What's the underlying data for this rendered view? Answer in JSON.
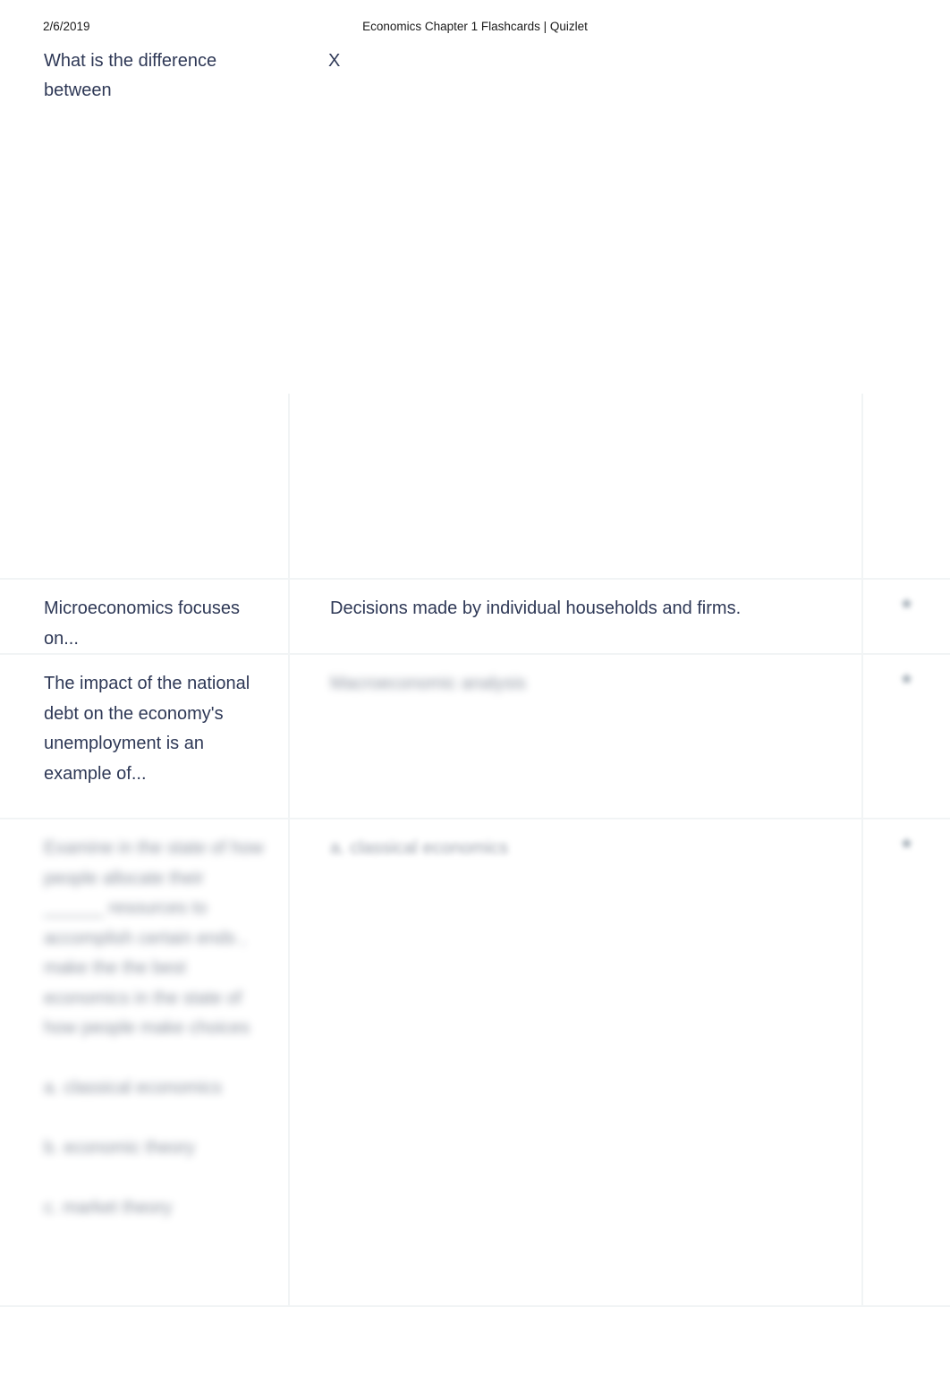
{
  "print_header": {
    "date": "2/6/2019",
    "document_title": "Economics Chapter 1 Flashcards | Quizlet"
  },
  "top_fragment": {
    "term": "What is the difference between",
    "definition": "X"
  },
  "colors": {
    "text": "#2e3856",
    "rule": "#f1f4f5",
    "header_text": "#1a1a1a",
    "star_icon": "#8d9aa5"
  },
  "icons": {
    "star": "star-icon"
  },
  "cards": [
    {
      "id": "ghost-row",
      "term": "",
      "definition": "",
      "legible": false,
      "render": "ghost",
      "star": ""
    },
    {
      "id": "microeconomics",
      "term": "Microeconomics focuses on...",
      "definition": "Decisions made by individual households and firms.",
      "legible": true,
      "render": "clear",
      "star": "star-icon"
    },
    {
      "id": "national-debt",
      "term": "The impact of the national debt on the economy's unemployment is an example of...",
      "definition": "Macroeconomic analysis",
      "legible": false,
      "render": "blurred-definition",
      "star": "star-icon"
    },
    {
      "id": "multiple-choice",
      "term": "Examine in the state of how people allocate their ______ resources to accomplish certain ends , make the the best economics in the state of how people make choices",
      "term_options": [
        "a. classical economics",
        "b. economic theory",
        "c. market theory"
      ],
      "definition": "a. classical economics",
      "legible": false,
      "render": "blurred",
      "star": "star-icon"
    }
  ]
}
